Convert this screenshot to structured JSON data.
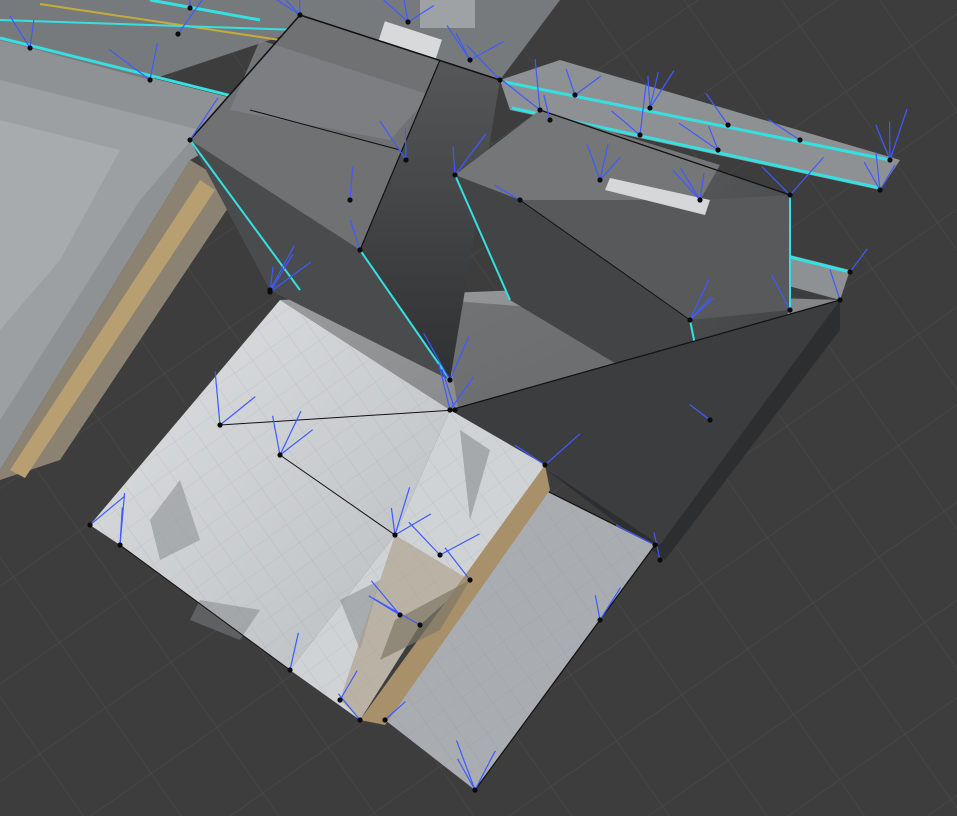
{
  "viewport": {
    "kind": "3d-viewport-mesh-edit",
    "background": "#3d3d3d",
    "grid_color": "#4a4a4a",
    "colors": {
      "selected_edge": "#36e0e0",
      "normal_line": "#3d5bff",
      "vertex": "#0b0b0b",
      "edge": "#111111",
      "asphalt": "#777a7c",
      "road_marking": "#c8aa3a",
      "concrete_light": "#d6d8d9",
      "concrete_mid": "#b8bdc1",
      "building_dark": "#4a4b4d",
      "building_glass": "#5c5e60",
      "ground_dark": "#6b6e70",
      "storefront": "#a88f6a"
    },
    "icons": [
      "vertex-dot-icon",
      "normal-line-icon"
    ]
  }
}
